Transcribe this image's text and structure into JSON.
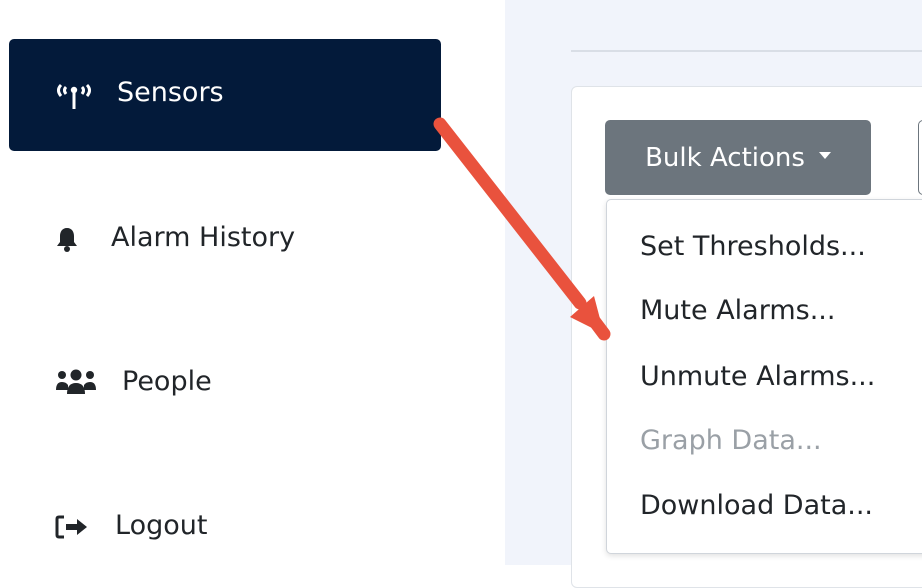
{
  "sidebar": {
    "items": [
      {
        "label": "Sensors",
        "icon": "broadcast-tower-icon",
        "active": true
      },
      {
        "label": "Alarm History",
        "icon": "bell-icon",
        "active": false
      },
      {
        "label": "People",
        "icon": "users-icon",
        "active": false
      },
      {
        "label": "Logout",
        "icon": "sign-out-icon",
        "active": false
      }
    ]
  },
  "toolbar": {
    "bulk_actions_label": "Bulk Actions"
  },
  "bulk_menu": {
    "items": [
      {
        "label": "Set Thresholds...",
        "enabled": true
      },
      {
        "label": "Mute Alarms...",
        "enabled": true
      },
      {
        "label": "Unmute Alarms...",
        "enabled": true
      },
      {
        "label": "Graph Data...",
        "enabled": false
      },
      {
        "label": "Download Data...",
        "enabled": true
      }
    ]
  },
  "colors": {
    "sidebar_active_bg": "#031a3a",
    "button_bg": "#6c757d",
    "annotation_arrow": "#e9523d",
    "main_bg": "#f1f4fb"
  }
}
